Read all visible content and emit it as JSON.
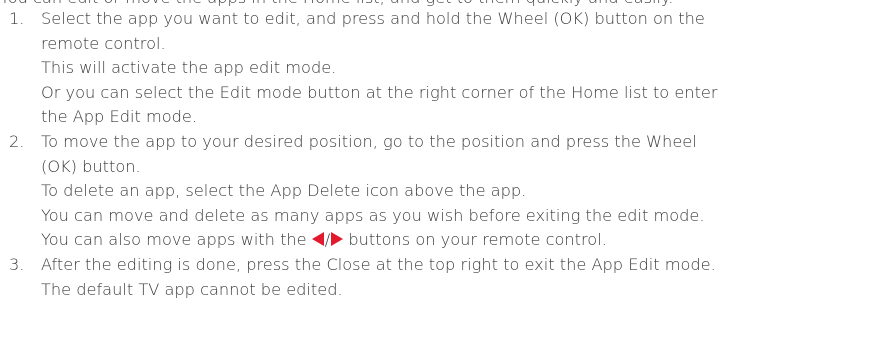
{
  "partial_top_line": "You can edit or move the apps in the Home list, and get to them quickly and easily.",
  "steps": [
    {
      "number": "1.",
      "lines": [
        "Select the app you want to edit, and press and hold the Wheel (OK) button on the",
        "remote control.",
        "This will activate the app edit mode.",
        "Or you can select the Edit mode button at the right corner of the Home list to enter",
        "the App Edit mode."
      ]
    },
    {
      "number": "2.",
      "lines": [
        "To move the app to your desired position, go to the position and press the Wheel",
        "(OK) button.",
        "To delete an app, select the App Delete icon above the app.",
        "You can move and delete as many apps as you wish before exiting the edit mode."
      ],
      "arrow_line": {
        "before": "You can also move apps with the ",
        "slash": "/",
        "after": " buttons on your remote control."
      }
    },
    {
      "number": "3.",
      "lines": [
        "After the editing is done, press the Close at the top right to exit the App Edit mode.",
        "The default TV app cannot be edited."
      ]
    }
  ],
  "icons": {
    "left": "left-arrow-button-icon",
    "right": "right-arrow-button-icon",
    "color": "#e3192d"
  }
}
